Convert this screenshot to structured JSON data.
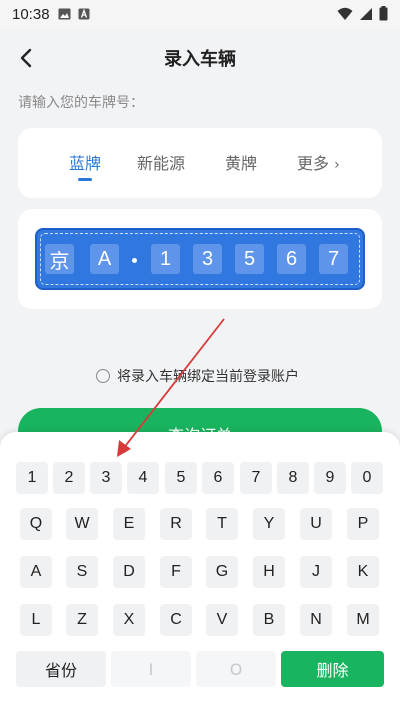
{
  "status_bar": {
    "time": "10:38"
  },
  "nav": {
    "title": "录入车辆"
  },
  "prompt": "请输入您的车牌号：",
  "plate_types": [
    {
      "label": "蓝牌"
    },
    {
      "label": "新能源"
    },
    {
      "label": "黄牌"
    },
    {
      "label": "更多"
    }
  ],
  "plate_types_more_glyph": "›",
  "plate": {
    "chars": [
      "京",
      "A",
      "1",
      "3",
      "5",
      "6",
      "7"
    ],
    "color": "#3177e0"
  },
  "bind_option": {
    "label": "将录入车辆绑定当前登录账户",
    "checked": false
  },
  "query_button": {
    "label": "查询订单"
  },
  "keyboard": {
    "row1": [
      "1",
      "2",
      "3",
      "4",
      "5",
      "6",
      "7",
      "8",
      "9",
      "0"
    ],
    "row2": [
      "Q",
      "W",
      "E",
      "R",
      "T",
      "Y",
      "U",
      "P"
    ],
    "row3": [
      "A",
      "S",
      "D",
      "F",
      "G",
      "H",
      "J",
      "K"
    ],
    "row4": [
      "L",
      "Z",
      "X",
      "C",
      "V",
      "B",
      "N",
      "M"
    ],
    "bottom": {
      "province": "省份",
      "key_i": "I",
      "key_o": "O",
      "delete": "删除"
    }
  },
  "colors": {
    "accent": "#2c78d9",
    "primary_green": "#19b45f",
    "annotation_arrow": "#d63a3a"
  }
}
